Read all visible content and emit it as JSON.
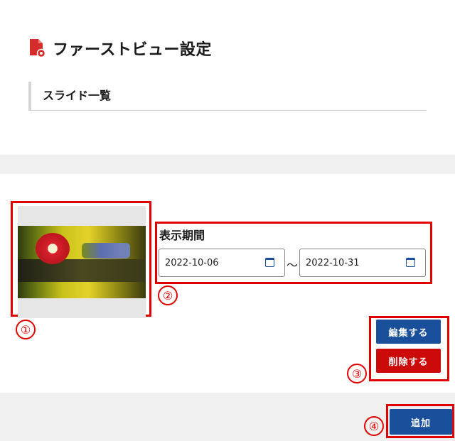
{
  "page_title": "ファーストビュー設定",
  "section_title": "スライド一覧",
  "slide": {
    "period_label": "表示期間",
    "start_date": "2022-10-06",
    "end_date": "2022-10-31",
    "range_separator": "～",
    "edit_label": "編集する",
    "delete_label": "削除する"
  },
  "add_label": "追加",
  "annotations": [
    "①",
    "②",
    "③",
    "④"
  ],
  "colors": {
    "primary": "#1a4f9c",
    "danger": "#cc0a0a",
    "annotation": "#e00000"
  }
}
